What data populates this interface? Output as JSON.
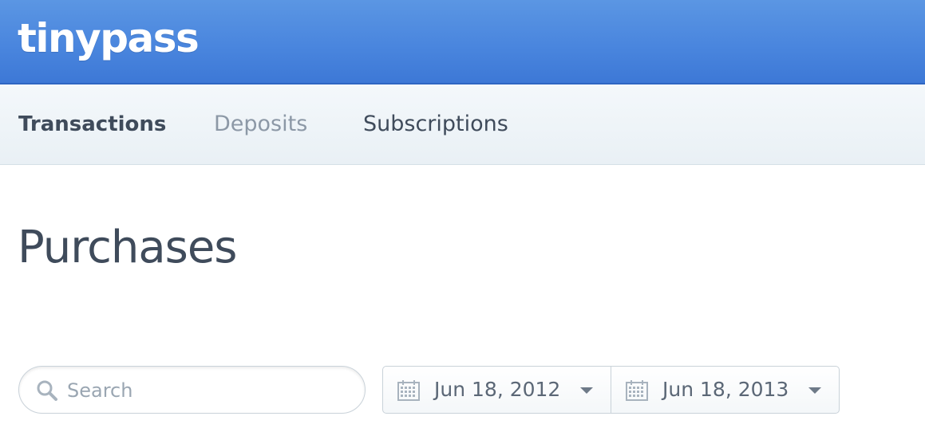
{
  "brand": {
    "logo_text": "tinypass",
    "header_color": "#4a86de"
  },
  "subnav": {
    "tabs": [
      {
        "label": "Transactions",
        "active": true
      },
      {
        "label": "Deposits",
        "active": false
      },
      {
        "label": "Subscriptions",
        "active": false
      }
    ]
  },
  "page": {
    "title": "Purchases"
  },
  "filters": {
    "search": {
      "placeholder": "Search",
      "value": "",
      "icon": "search-icon"
    },
    "date_range": {
      "from": "Jun 18, 2012",
      "to": "Jun 18, 2013",
      "icon": "calendar-icon"
    }
  }
}
